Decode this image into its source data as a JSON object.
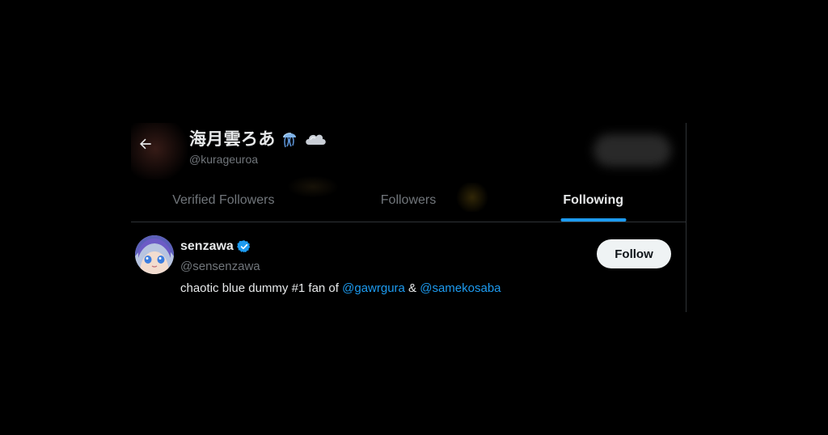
{
  "header": {
    "title": "海月雲ろあ",
    "title_emojis": [
      "jellyfish-icon",
      "cloud-icon"
    ],
    "handle": "@kurageuroa",
    "back_icon": "arrow-left-icon"
  },
  "tabs": [
    {
      "label": "Verified Followers",
      "active": false
    },
    {
      "label": "Followers",
      "active": false
    },
    {
      "label": "Following",
      "active": true
    }
  ],
  "users": [
    {
      "name": "senzawa",
      "verified": true,
      "handle": "@sensenzawa",
      "bio": {
        "prefix": "chaotic blue dummy #1 fan of ",
        "mention1": "@gawrgura",
        "middle": " & ",
        "mention2": "@samekosaba"
      },
      "follow_label": "Follow"
    }
  ],
  "colors": {
    "background": "#000000",
    "accent": "#1d9bf0",
    "text_primary": "#e7e9ea",
    "text_secondary": "#71767b",
    "border": "#2f3336",
    "button_bg": "#eff3f4"
  }
}
